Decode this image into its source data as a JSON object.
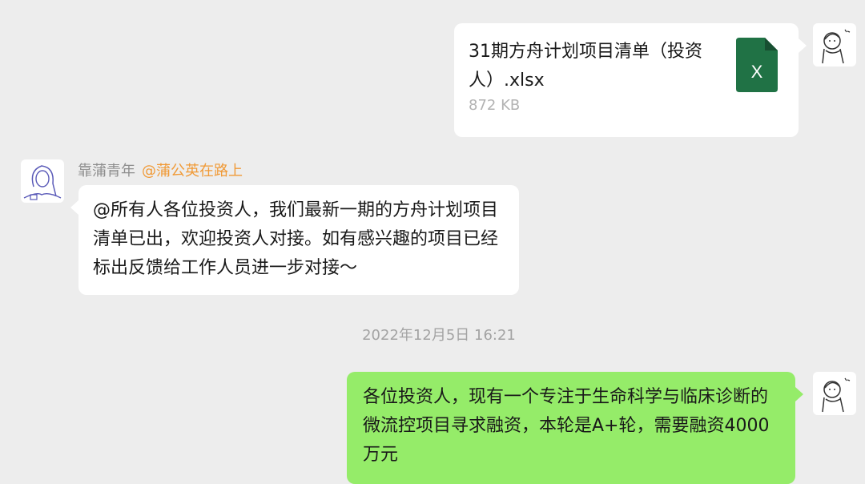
{
  "file_message": {
    "file_name": "31期方舟计划项目清单（投资人）.xlsx",
    "file_size": "872 KB",
    "icon": "excel-file-icon",
    "icon_letter": "X",
    "icon_color": "#207245"
  },
  "group_message": {
    "sender_name": "靠蒲青年",
    "mention": "@蒲公英在路上",
    "text": "@所有人各位投资人，我们最新一期的方舟计划项目清单已出，欢迎投资人对接。如有感兴趣的项目已经标出反馈给工作人员进一步对接～"
  },
  "timestamp": "2022年12月5日 16:21",
  "outgoing_message": {
    "text": "各位投资人，现有一个专注于生命科学与临床诊断的微流控项目寻求融资，本轮是A+轮，需要融资4000万元"
  },
  "colors": {
    "background": "#ededed",
    "outgoing_bubble": "#95ec69",
    "incoming_bubble": "#ffffff",
    "mention": "#f09a37"
  }
}
